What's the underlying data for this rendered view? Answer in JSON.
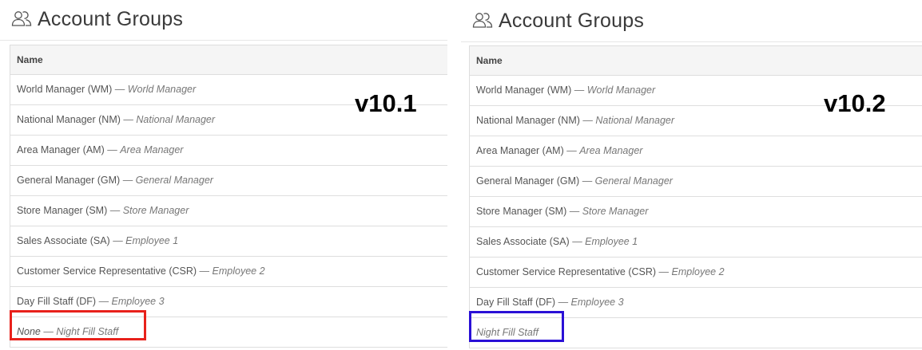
{
  "left": {
    "title": "Account Groups",
    "version": "v10.1",
    "column_header": "Name",
    "rows": [
      {
        "name": "World Manager (WM)",
        "sep": " — ",
        "role": "World Manager"
      },
      {
        "name": "National Manager (NM)",
        "sep": " — ",
        "role": "National Manager"
      },
      {
        "name": "Area Manager (AM)",
        "sep": " — ",
        "role": "Area Manager"
      },
      {
        "name": "General Manager (GM)",
        "sep": " — ",
        "role": "General Manager"
      },
      {
        "name": "Store Manager (SM)",
        "sep": " — ",
        "role": "Store Manager"
      },
      {
        "name": "Sales Associate (SA)",
        "sep": " — ",
        "role": "Employee 1"
      },
      {
        "name": "Customer Service Representative (CSR)",
        "sep": " — ",
        "role": "Employee 2"
      },
      {
        "name": "Day Fill Staff (DF)",
        "sep": " — ",
        "role": "Employee 3"
      },
      {
        "name": "None",
        "sep": " — ",
        "role": "Night Fill Staff"
      }
    ],
    "highlight_color": "#e8211b"
  },
  "right": {
    "title": "Account Groups",
    "version": "v10.2",
    "column_header": "Name",
    "rows": [
      {
        "name": "World Manager (WM)",
        "sep": " — ",
        "role": "World Manager"
      },
      {
        "name": "National Manager (NM)",
        "sep": " — ",
        "role": "National Manager"
      },
      {
        "name": "Area Manager (AM)",
        "sep": " — ",
        "role": "Area Manager"
      },
      {
        "name": "General Manager (GM)",
        "sep": " — ",
        "role": "General Manager"
      },
      {
        "name": "Store Manager (SM)",
        "sep": " — ",
        "role": "Store Manager"
      },
      {
        "name": "Sales Associate (SA)",
        "sep": " — ",
        "role": "Employee 1"
      },
      {
        "name": "Customer Service Representative (CSR)",
        "sep": " — ",
        "role": "Employee 2"
      },
      {
        "name": "Day Fill Staff (DF)",
        "sep": " — ",
        "role": "Employee 3"
      },
      {
        "name": "",
        "sep": "",
        "role": "Night Fill Staff"
      }
    ],
    "highlight_color": "#2a10d6"
  },
  "icons": {
    "title_icon": "users-icon"
  }
}
